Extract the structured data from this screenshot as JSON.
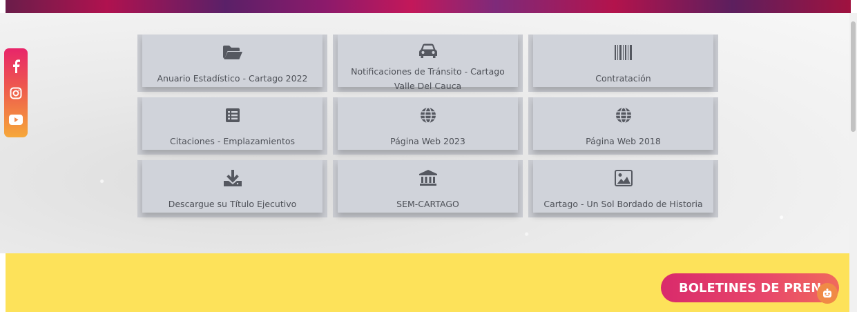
{
  "social": [
    {
      "name": "facebook-icon",
      "glyph": "f"
    },
    {
      "name": "instagram-icon"
    },
    {
      "name": "youtube-icon"
    }
  ],
  "tiles": [
    {
      "icon": "folder-open-icon",
      "label": "Anuario Estadístico - Cartago 2022"
    },
    {
      "icon": "car-icon",
      "label": "Notificaciones de Tránsito - Cartago Valle Del Cauca"
    },
    {
      "icon": "barcode-icon",
      "label": "Contratación"
    },
    {
      "icon": "list-icon",
      "label": "Citaciones - Emplazamientos"
    },
    {
      "icon": "globe-icon",
      "label": "Página Web 2023"
    },
    {
      "icon": "globe-icon",
      "label": "Página Web 2018"
    },
    {
      "icon": "download-icon",
      "label": "Descargue su Título Ejecutivo"
    },
    {
      "icon": "bank-icon",
      "label": "SEM-CARTAGO"
    },
    {
      "icon": "image-icon",
      "label": "Cartago - Un Sol Bordado de Historia"
    }
  ],
  "press_button": {
    "label": "BOLETINES DE PREN"
  },
  "colors": {
    "tile_bg": "#d0d3da",
    "tile_text": "#4d5057",
    "icon_color": "#555860",
    "yellow_section": "#fde25a",
    "press_gradient_start": "#d92a6b",
    "chat_bot": "#f08a46"
  }
}
